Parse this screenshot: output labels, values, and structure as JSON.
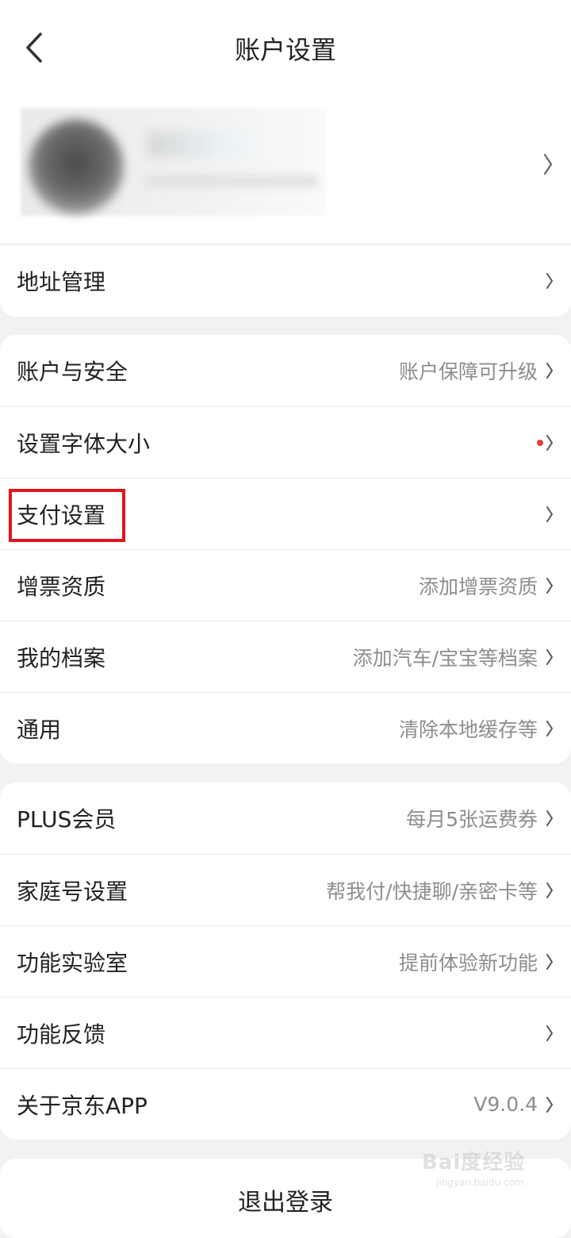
{
  "header": {
    "title": "账户设置"
  },
  "address_card": {
    "label": "地址管理"
  },
  "group1": [
    {
      "label": "账户与安全",
      "value": "账户保障可升级"
    },
    {
      "label": "设置字体大小",
      "value": ""
    },
    {
      "label": "支付设置",
      "value": ""
    },
    {
      "label": "增票资质",
      "value": "添加增票资质"
    },
    {
      "label": "我的档案",
      "value": "添加汽车/宝宝等档案"
    },
    {
      "label": "通用",
      "value": "清除本地缓存等"
    }
  ],
  "group2": [
    {
      "label": "PLUS会员",
      "value": "每月5张运费券"
    },
    {
      "label": "家庭号设置",
      "value": "帮我付/快捷聊/亲密卡等"
    },
    {
      "label": "功能实验室",
      "value": "提前体验新功能"
    },
    {
      "label": "功能反馈",
      "value": ""
    },
    {
      "label": "关于京东APP",
      "value": "V9.0.4"
    }
  ],
  "logout": {
    "label": "退出登录"
  },
  "watermark": {
    "brand": "Bai度经验",
    "url": "jingyan.baidu.com"
  },
  "colors": {
    "accent_red": "#e0141e",
    "dot_red": "#e5393f"
  }
}
